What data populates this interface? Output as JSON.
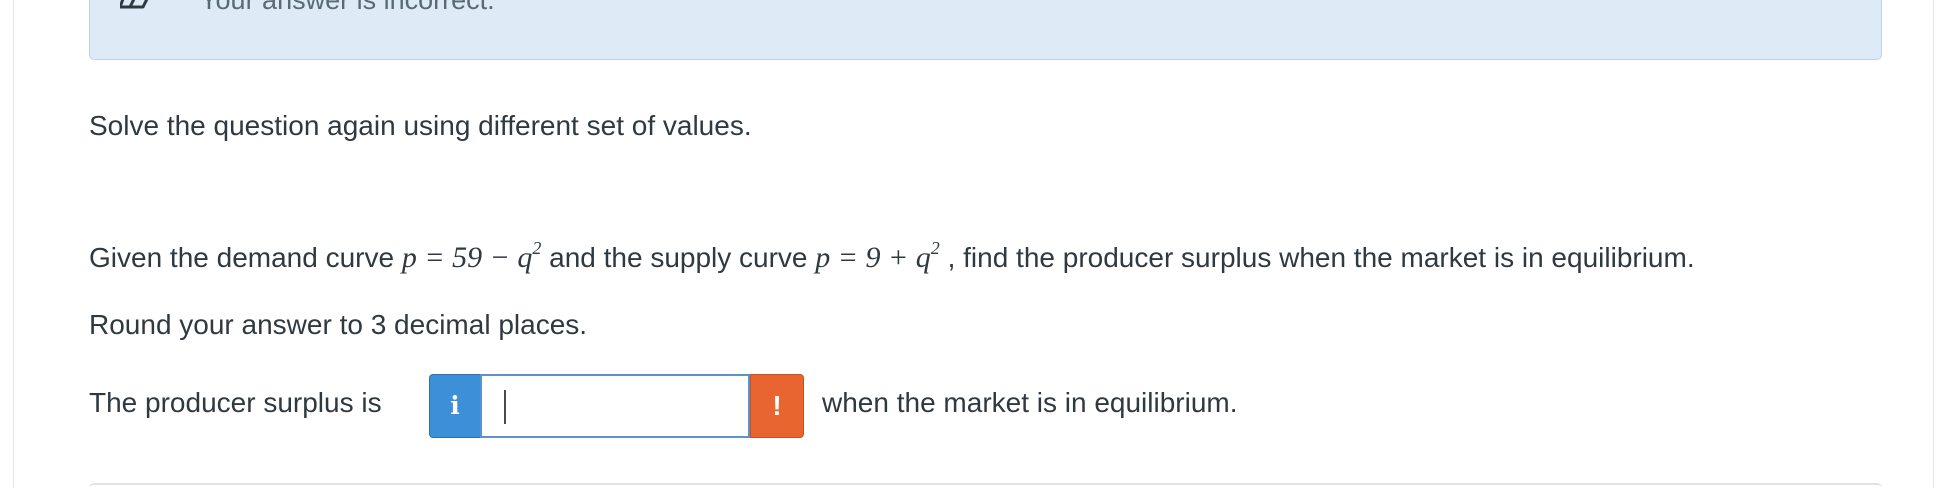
{
  "feedback": {
    "icon": "eraser-icon",
    "message": "Your answer is incorrect."
  },
  "instruction": "Solve the question again using different set of values.",
  "question": {
    "intro": "Given the demand curve ",
    "demand_curve": "p = 59 − q",
    "demand_exponent": "2",
    "middle": " and the supply curve ",
    "supply_curve": "p = 9 + q",
    "supply_exponent": "2",
    "ending": " , find the producer surplus when the market is in equilibrium."
  },
  "rounding_instruction": "Round your answer to 3 decimal places.",
  "answer": {
    "label": "The producer surplus is",
    "info_icon": "info-icon",
    "info_symbol": "i",
    "input_value": "",
    "warning_icon": "warning-icon",
    "warning_symbol": "!",
    "suffix": "when the market is in equilibrium."
  },
  "colors": {
    "feedback_background": "#deebf7",
    "info_button": "#3d8fd8",
    "warning_button": "#e86530",
    "input_border": "#5e93c9"
  }
}
